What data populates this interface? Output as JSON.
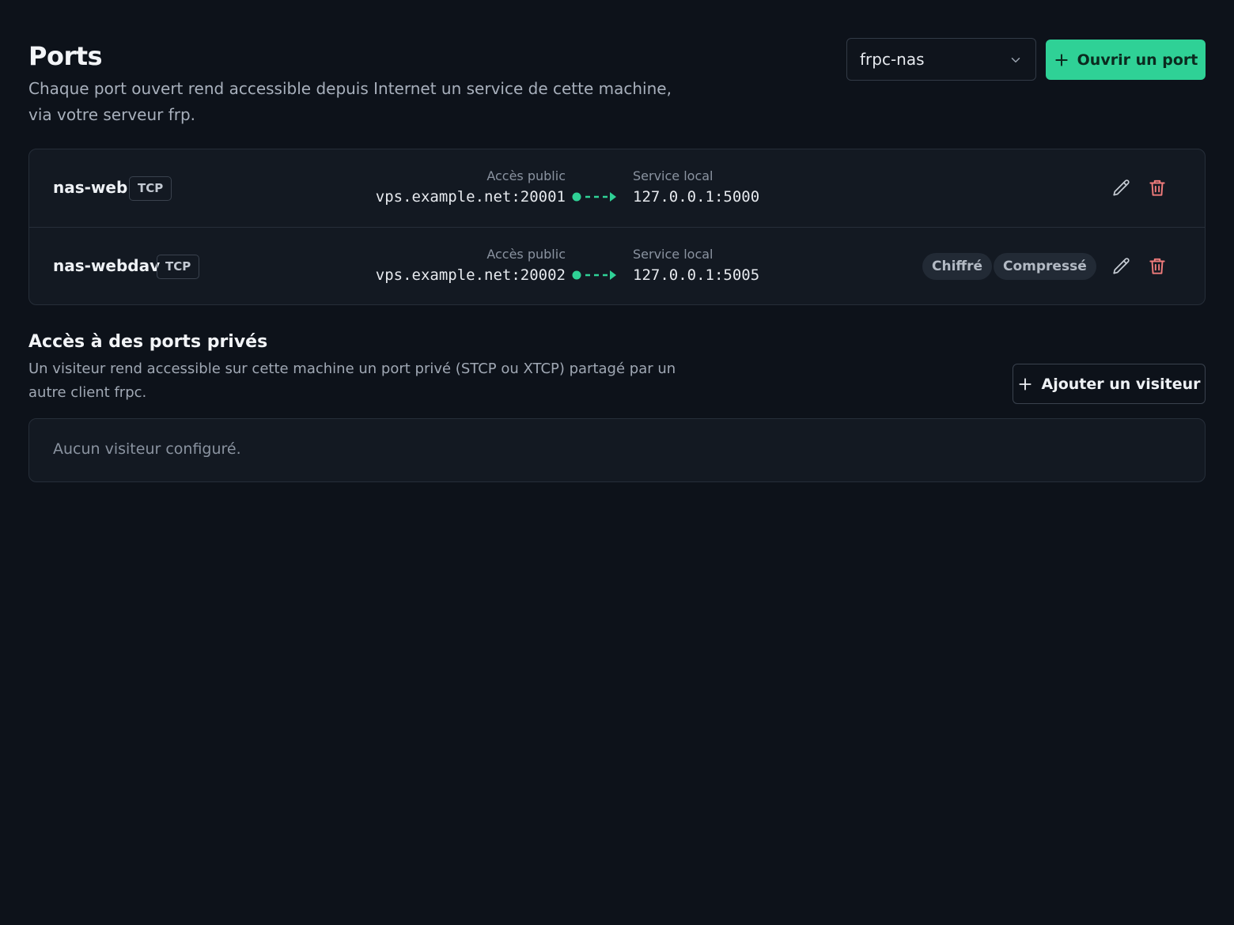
{
  "header": {
    "title": "Ports",
    "description": "Chaque port ouvert rend accessible depuis Internet un service de cette machine, via votre serveur frp.",
    "machine_select": {
      "value": "frpc-nas"
    },
    "open_port_label": "Ouvrir un port"
  },
  "labels": {
    "public_access": "Accès public",
    "local_service": "Service local"
  },
  "ports": [
    {
      "name": "nas-web",
      "protocol": "TCP",
      "public": "vps.example.net:20001",
      "local": "127.0.0.1:5000",
      "tags": []
    },
    {
      "name": "nas-webdav",
      "protocol": "TCP",
      "public": "vps.example.net:20002",
      "local": "127.0.0.1:5005",
      "tags": [
        "Chiffré",
        "Compressé"
      ]
    }
  ],
  "visitors": {
    "title": "Accès à des ports privés",
    "description": "Un visiteur rend accessible sur cette machine un port privé (STCP ou XTCP) partagé par un autre client frpc.",
    "add_label": "Ajouter un visiteur",
    "empty_text": "Aucun visiteur configuré."
  },
  "colors": {
    "accent": "#2fd196",
    "danger": "#f07b7b",
    "background": "#0d121a",
    "card": "#131922"
  }
}
